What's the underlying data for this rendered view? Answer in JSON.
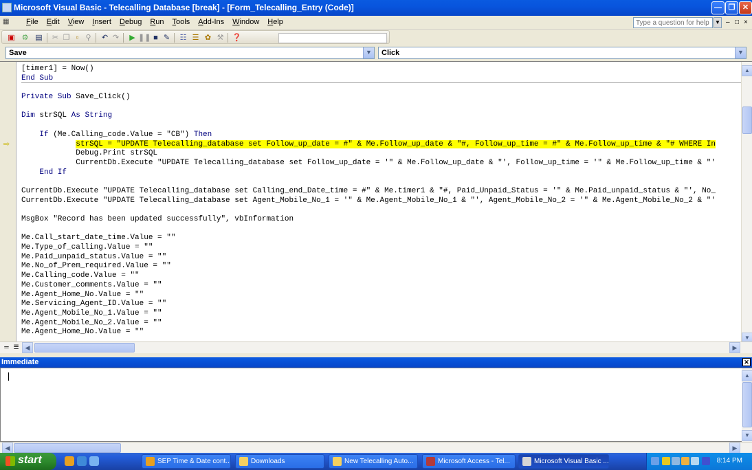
{
  "window": {
    "title": "Microsoft Visual Basic - Telecalling Database [break] - [Form_Telecalling_Entry (Code)]"
  },
  "menubar": {
    "items": [
      "File",
      "Edit",
      "View",
      "Insert",
      "Debug",
      "Run",
      "Tools",
      "Add-Ins",
      "Window",
      "Help"
    ],
    "help_placeholder": "Type a question for help"
  },
  "combos": {
    "object": "Save",
    "procedure": "Click"
  },
  "code": {
    "lines": [
      "[timer1] = Now()",
      "End Sub",
      "",
      "Private Sub Save_Click()",
      "",
      "Dim strSQL As String",
      "",
      "    If (Me.Calling_code.Value = \"CB\") Then",
      "            strSQL = \"UPDATE Telecalling_database set Follow_up_date = #\" & Me.Follow_up_date & \"#, Follow_up_time = #\" & Me.Follow_up_time & \"# WHERE In",
      "            Debug.Print strSQL",
      "            CurrentDb.Execute \"UPDATE Telecalling_database set Follow_up_date = '\" & Me.Follow_up_date & \"', Follow_up_time = '\" & Me.Follow_up_time & \"'",
      "    End If",
      "",
      "CurrentDb.Execute \"UPDATE Telecalling_database set Calling_end_Date_time = #\" & Me.timer1 & \"#, Paid_Unpaid_Status = '\" & Me.Paid_unpaid_status & \"', No_",
      "CurrentDb.Execute \"UPDATE Telecalling_database set Agent_Mobile_No_1 = '\" & Me.Agent_Mobile_No_1 & \"', Agent_Mobile_No_2 = '\" & Me.Agent_Mobile_No_2 & \"'",
      "",
      "MsgBox \"Record has been updated successfully\", vbInformation",
      "",
      "Me.Call_start_date_time.Value = \"\"",
      "Me.Type_of_calling.Value = \"\"",
      "Me.Paid_unpaid_status.Value = \"\"",
      "Me.No_of_Prem_required.Value = \"\"",
      "Me.Calling_code.Value = \"\"",
      "Me.Customer_comments.Value = \"\"",
      "Me.Agent_Home_No.Value = \"\"",
      "Me.Servicing_Agent_ID.Value = \"\"",
      "Me.Agent_Mobile_No_1.Value = \"\"",
      "Me.Agent_Mobile_No_2.Value = \"\"",
      "Me.Agent_Home_No.Value = \"\""
    ],
    "highlight_color": "#ffff00"
  },
  "immediate": {
    "title": "Immediate"
  },
  "taskbar": {
    "start_label": "start",
    "tasks": [
      "SEP Time & Date cont...",
      "Downloads",
      "New Telecalling Auto...",
      "Microsoft Access - Tel...",
      "Microsoft Visual Basic ..."
    ],
    "clock": "8:14 PM"
  }
}
